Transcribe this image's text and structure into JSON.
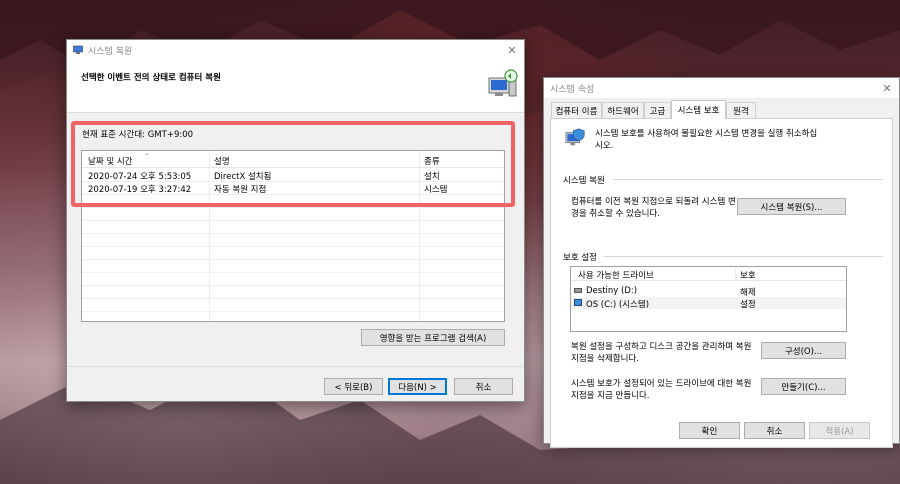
{
  "restore_wizard": {
    "title": "시스템 복원",
    "heading": "선택한 이벤트 전의 상태로 컴퓨터 복원",
    "timezone": "현재 표준 시간대: GMT+9:00",
    "columns": [
      "날짜 및 시간",
      "설명",
      "종류"
    ],
    "rows": [
      {
        "date": "2020-07-24 오후 5:53:05",
        "description": "DirectX 설치됨",
        "type": "설치"
      },
      {
        "date": "2020-07-19 오후 3:27:42",
        "description": "자동 복원 지점",
        "type": "시스템"
      }
    ],
    "scan_button": "영향을 받는 프로그램 검색(A)",
    "back_button": "< 뒤로(B)",
    "next_button": "다음(N) >",
    "cancel_button": "취소"
  },
  "system_properties": {
    "title": "시스템 속성",
    "tabs": [
      "컴퓨터 이름",
      "하드웨어",
      "고급",
      "시스템 보호",
      "원격"
    ],
    "active_tab": 3,
    "intro": "시스템 보호를 사용하여 불필요한 시스템 변경을 실행 취소하십시오.",
    "restore_section": "시스템 복원",
    "restore_text": "컴퓨터를 이전 복원 지점으로 되돌려 시스템 변경을 취소할 수 있습니다.",
    "restore_button": "시스템 복원(S)...",
    "protection_section": "보호 설정",
    "drive_columns": [
      "사용 가능한 드라이브",
      "보호"
    ],
    "drives": [
      {
        "name": "Destiny (D:)",
        "protection": "해제"
      },
      {
        "name": "OS (C:) (시스템)",
        "protection": "설정"
      }
    ],
    "configure_text": "복원 설정을 구성하고 디스크 공간을 관리하며 복원 지점을 삭제합니다.",
    "configure_button": "구성(O)...",
    "create_text": "시스템 보호가 설정되어 있는 드라이브에 대한 복원 지점을 지금 만듭니다.",
    "create_button": "만들기(C)...",
    "ok_button": "확인",
    "cancel_button": "취소",
    "apply_button": "적용(A)"
  },
  "colors": {
    "highlight": "#f26366",
    "accent": "#0078d7"
  }
}
